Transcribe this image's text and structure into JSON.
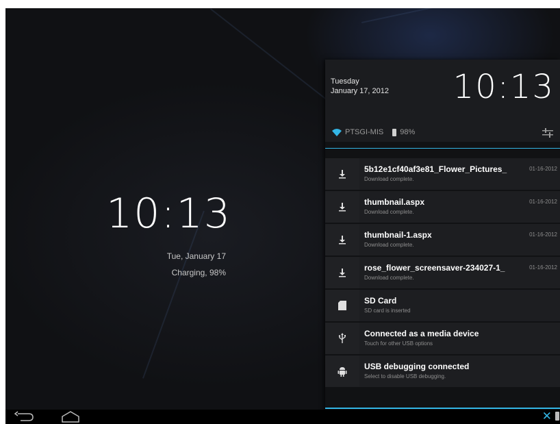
{
  "lockscreen": {
    "time": "10:13",
    "date": "Tue, January 17",
    "charging": "Charging, 98%"
  },
  "panel": {
    "day": "Tuesday",
    "date": "January 17, 2012",
    "time": "10:13",
    "network_name": "PTSGI-MIS",
    "battery": "98%",
    "accent_color": "#33b5e5"
  },
  "notifications": [
    {
      "icon": "download-icon",
      "title": "5b12e1cf40af3e81_Flower_Pictures_",
      "subtitle": "Download complete.",
      "time": "01-16-2012"
    },
    {
      "icon": "download-icon",
      "title": "thumbnail.aspx",
      "subtitle": "Download complete.",
      "time": "01-16-2012"
    },
    {
      "icon": "download-icon",
      "title": "thumbnail-1.aspx",
      "subtitle": "Download complete.",
      "time": "01-16-2012"
    },
    {
      "icon": "download-icon",
      "title": "rose_flower_screensaver-234027-1_",
      "subtitle": "Download complete.",
      "time": "01-16-2012"
    },
    {
      "icon": "sd-card-icon",
      "title": "SD Card",
      "subtitle": "SD card is inserted",
      "time": ""
    },
    {
      "icon": "usb-icon",
      "title": "Connected as a media device",
      "subtitle": "Touch for other USB options",
      "time": ""
    },
    {
      "icon": "android-debug-icon",
      "title": "USB debugging connected",
      "subtitle": "Select to disable USB debugging.",
      "time": ""
    }
  ]
}
